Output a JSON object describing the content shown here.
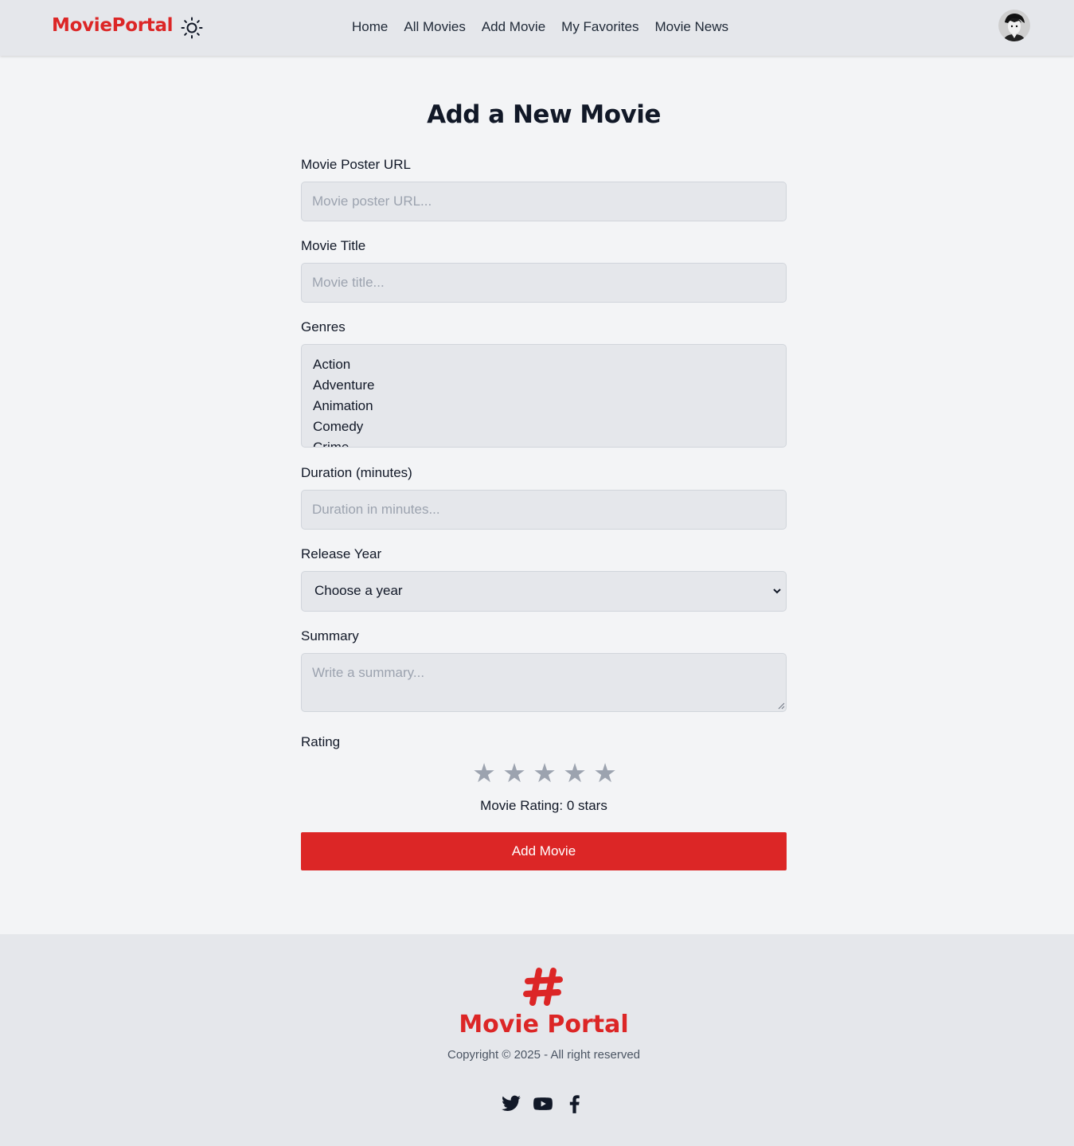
{
  "navbar": {
    "brand": "MoviePortal",
    "theme_icon": "sun-icon",
    "links": [
      "Home",
      "All Movies",
      "Add Movie",
      "My Favorites",
      "Movie News"
    ]
  },
  "form": {
    "title": "Add a New Movie",
    "poster": {
      "label": "Movie Poster URL",
      "placeholder": "Movie poster URL...",
      "value": ""
    },
    "movie_title": {
      "label": "Movie Title",
      "placeholder": "Movie title...",
      "value": ""
    },
    "genres": {
      "label": "Genres",
      "options": [
        "Action",
        "Adventure",
        "Animation",
        "Comedy",
        "Crime"
      ]
    },
    "duration": {
      "label": "Duration (minutes)",
      "placeholder": "Duration in minutes...",
      "value": ""
    },
    "release_year": {
      "label": "Release Year",
      "selected": "Choose a year"
    },
    "summary": {
      "label": "Summary",
      "placeholder": "Write a summary...",
      "value": ""
    },
    "rating": {
      "label": "Rating",
      "stars_total": 5,
      "value": 0,
      "text": "Movie Rating: 0 stars"
    },
    "submit_label": "Add Movie"
  },
  "footer": {
    "logo_icon": "hashtag-icon",
    "title": "Movie Portal",
    "copyright": "Copyright © 2025 - All right reserved",
    "social_icons": [
      "twitter-icon",
      "youtube-icon",
      "facebook-icon"
    ]
  },
  "colors": {
    "accent": "#dc2626",
    "background": "#f3f4f6",
    "surface": "#e5e7eb",
    "star_inactive": "#9ca3af"
  }
}
